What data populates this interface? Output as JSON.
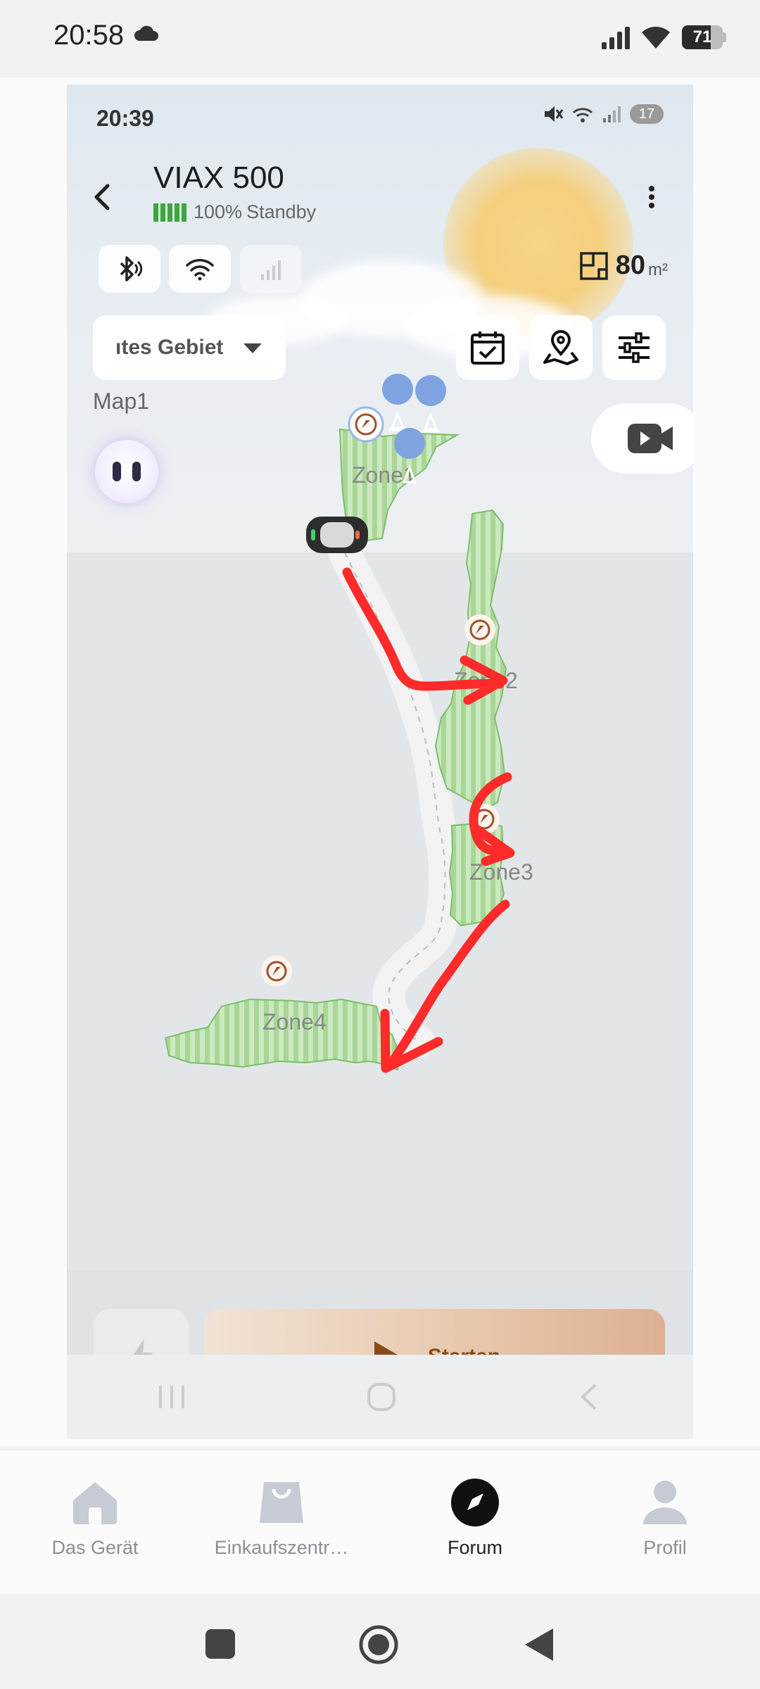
{
  "outer_status": {
    "time": "20:58",
    "battery": "71"
  },
  "inner_status": {
    "time": "20:39",
    "battery": "17"
  },
  "device": {
    "name": "VIAX 500",
    "battery_percent": "100%",
    "state": "Standby"
  },
  "area": {
    "value": "80",
    "unit": "m²"
  },
  "zone_select": {
    "value": "ıtes Gebiet"
  },
  "map": {
    "name": "Map1",
    "zones": [
      "Zone1",
      "Zone2",
      "Zone3",
      "Zone4"
    ]
  },
  "actions": {
    "start_label": "Starten"
  },
  "tabs": [
    {
      "label": "Das Gerät",
      "icon": "home-icon"
    },
    {
      "label": "Einkaufszentr…",
      "icon": "shopping-bag-icon"
    },
    {
      "label": "Forum",
      "icon": "compass-icon",
      "active": true
    },
    {
      "label": "Profil",
      "icon": "person-icon"
    }
  ],
  "colors": {
    "zone_fill": "#b5dca5",
    "annotation_red": "#ff2a2a",
    "battery_green": "#3aa83a",
    "start_text": "#8a4a15"
  }
}
